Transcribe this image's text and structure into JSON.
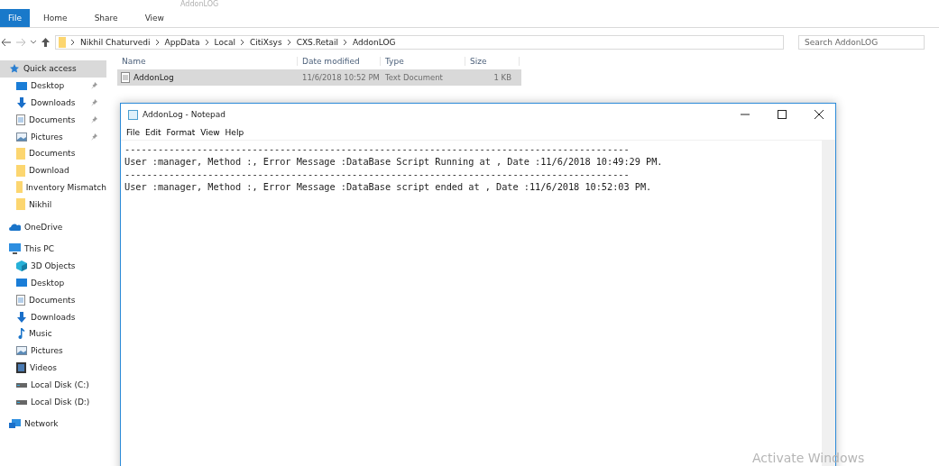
{
  "explorer": {
    "title": "AddonLOG",
    "ribbon_tabs": [
      {
        "label": "File",
        "selected": true
      },
      {
        "label": "Home",
        "selected": false
      },
      {
        "label": "Share",
        "selected": false
      },
      {
        "label": "View",
        "selected": false
      }
    ],
    "breadcrumb": [
      "Nikhil Chaturvedi",
      "AppData",
      "Local",
      "CitiXsys",
      "CXS.Retail",
      "AddonLOG"
    ],
    "search": {
      "placeholder": "Search AddonLOG"
    },
    "sidebar": [
      {
        "label": "Quick access",
        "selected": true,
        "pinned": false,
        "children": [
          {
            "label": "Desktop",
            "selected": false,
            "pinned": true
          },
          {
            "label": "Downloads",
            "selected": false,
            "pinned": true
          },
          {
            "label": "Documents",
            "selected": false,
            "pinned": true
          },
          {
            "label": "Pictures",
            "selected": false,
            "pinned": true
          },
          {
            "label": "Documents",
            "selected": false,
            "pinned": false
          },
          {
            "label": "Download",
            "selected": false,
            "pinned": false
          },
          {
            "label": "Inventory Mismatch",
            "selected": false,
            "pinned": false
          },
          {
            "label": "Nikhil",
            "selected": false,
            "pinned": false
          }
        ]
      },
      {
        "label": "OneDrive",
        "selected": false,
        "pinned": false
      },
      {
        "label": "This PC",
        "selected": false,
        "pinned": false,
        "children": [
          {
            "label": "3D Objects",
            "selected": false,
            "pinned": false
          },
          {
            "label": "Desktop",
            "selected": false,
            "pinned": false
          },
          {
            "label": "Documents",
            "selected": false,
            "pinned": false
          },
          {
            "label": "Downloads",
            "selected": false,
            "pinned": false
          },
          {
            "label": "Music",
            "selected": false,
            "pinned": false
          },
          {
            "label": "Pictures",
            "selected": false,
            "pinned": false
          },
          {
            "label": "Videos",
            "selected": false,
            "pinned": false
          },
          {
            "label": "Local Disk (C:)",
            "selected": false,
            "pinned": false
          },
          {
            "label": "Local Disk (D:)",
            "selected": false,
            "pinned": false
          }
        ]
      },
      {
        "label": "Network",
        "selected": false,
        "pinned": false
      }
    ],
    "table": {
      "columns": [
        "Name",
        "Date modified",
        "Type",
        "Size"
      ],
      "rows": [
        {
          "name": "AddonLog",
          "date": "11/6/2018 10:52 PM",
          "type": "Text Document",
          "size": "1 KB",
          "selected": true
        }
      ]
    }
  },
  "notepad": {
    "title": "AddonLog - Notepad",
    "menu": [
      "File",
      "Edit",
      "Format",
      "View",
      "Help"
    ],
    "lines": [
      "-------------------------------------------------------------------------------------------",
      "User :manager, Method :, Error Message :DataBase Script Running at , Date :11/6/2018 10:49:29 PM.",
      "-------------------------------------------------------------------------------------------",
      "User :manager, Method :, Error Message :DataBase script ended at , Date :11/6/2018 10:52:03 PM."
    ]
  },
  "activation_notice": "Activate Windows"
}
